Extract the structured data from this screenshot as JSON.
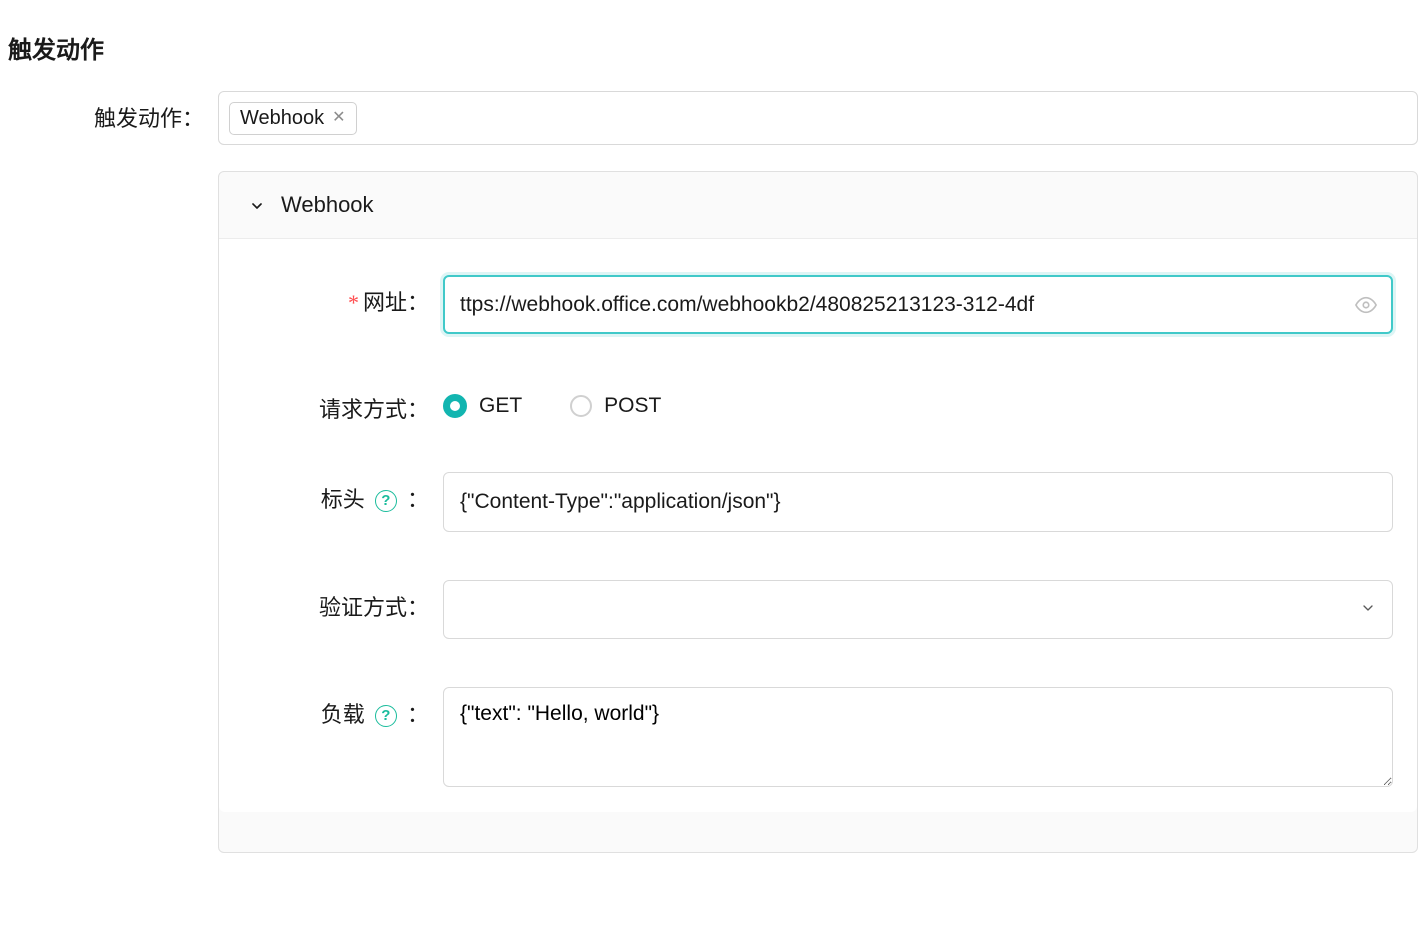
{
  "page_title": "触发动作",
  "trigger_action": {
    "label": "触发动作：",
    "tag_label": "Webhook"
  },
  "panel": {
    "title": "Webhook",
    "fields": {
      "url": {
        "label": "网址：",
        "value": "ttps://webhook.office.com/webhookb2/480825213123-312-4df"
      },
      "method": {
        "label": "请求方式：",
        "options": {
          "get": "GET",
          "post": "POST"
        },
        "selected": "get"
      },
      "headers": {
        "label": "标头",
        "suffix": "：",
        "value": "{\"Content-Type\":\"application/json\"}"
      },
      "auth": {
        "label": "验证方式：",
        "value": ""
      },
      "payload": {
        "label": "负载",
        "suffix": "：",
        "value": "{\"text\": \"Hello, world\"}"
      }
    }
  }
}
